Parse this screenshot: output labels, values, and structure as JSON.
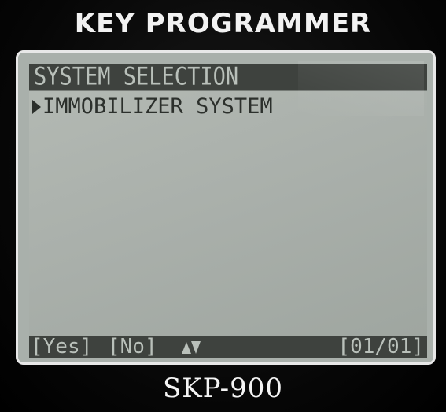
{
  "header": {
    "brand_label": "KEY PROGRAMMER"
  },
  "screen": {
    "title": "SYSTEM SELECTION",
    "menu_items": [
      {
        "label": "IMMOBILIZER SYSTEM",
        "selected": true
      }
    ],
    "softkeys": {
      "yes_label": "[Yes]",
      "no_label": "[No]",
      "updown_icon": "up-down-arrows-icon",
      "page_indicator": "[01/01]"
    }
  },
  "footer": {
    "model_label": "SKP-900"
  },
  "colors": {
    "lcd_background": "#aab0ab",
    "lcd_inverse_bar": "#3e423e",
    "bezel_border": "#e8e8e8",
    "device_body": "#0a0a0a"
  }
}
